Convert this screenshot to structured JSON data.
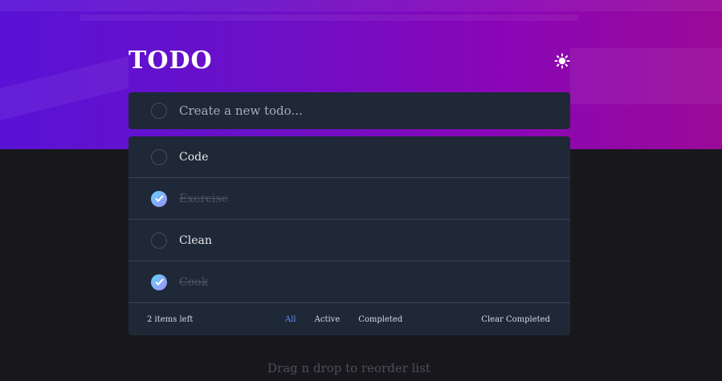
{
  "app": {
    "title": "TODO",
    "theme_icon": "sun-icon"
  },
  "new_todo": {
    "placeholder": "Create a new todo..."
  },
  "todos": [
    {
      "label": "Code",
      "completed": false
    },
    {
      "label": "Exercise",
      "completed": true
    },
    {
      "label": "Clean",
      "completed": false
    },
    {
      "label": "Cook",
      "completed": true
    }
  ],
  "footer": {
    "items_left": "2 items left",
    "filters": {
      "all": "All",
      "active": "Active",
      "completed": "Completed"
    },
    "active_filter": "all",
    "clear_completed": "Clear Completed"
  },
  "hint": "Drag n drop to reorder list",
  "colors": {
    "accent": "#5b8cf5",
    "card": "#1f2837",
    "background": "#18181c",
    "check_gradient_start": "#5fd3ff",
    "check_gradient_end": "#a48df5"
  }
}
